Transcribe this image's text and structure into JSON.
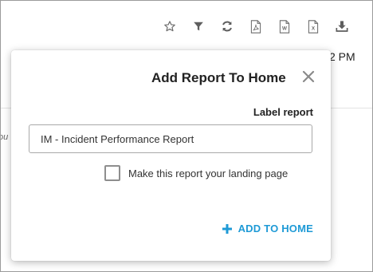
{
  "toolbar": {
    "icons": [
      "star-icon",
      "filter-icon",
      "refresh-icon",
      "pdf-icon",
      "word-icon",
      "excel-icon",
      "download-icon"
    ]
  },
  "background": {
    "time_fragment": "2 PM",
    "text_fragment": "ou"
  },
  "dialog": {
    "title": "Add Report To Home",
    "field_label": "Label report",
    "input_value": "IM - Incident Performance Report",
    "checkbox_label": "Make this report your landing page",
    "checkbox_checked": false,
    "add_button_label": "ADD TO HOME"
  },
  "colors": {
    "accent": "#1e9ad6",
    "icon": "#6b6b6b",
    "text": "#222222"
  }
}
